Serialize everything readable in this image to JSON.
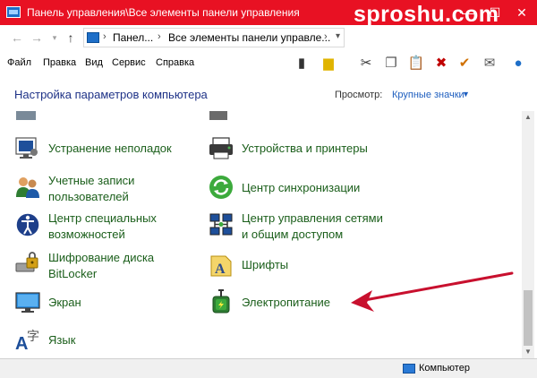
{
  "window": {
    "title": "Панель управления\\Все элементы панели управления",
    "watermark": "sproshu.com",
    "controls": {
      "minimize": "—",
      "maximize": "☐",
      "close": "✕"
    }
  },
  "address": {
    "crumbs": [
      "Панел...",
      "Все элементы панели управле..."
    ],
    "separator": "›"
  },
  "menu": {
    "items": [
      "Файл",
      "Правка",
      "Вид",
      "Сервис",
      "Справка"
    ]
  },
  "toolbar": {
    "buttons": [
      {
        "icon": "panel-icon",
        "glyph": "▮"
      },
      {
        "icon": "folder-icon",
        "glyph": "▆"
      },
      {
        "icon": "cut-icon",
        "glyph": "✂"
      },
      {
        "icon": "copy-icon",
        "glyph": "❐"
      },
      {
        "icon": "paste-icon",
        "glyph": "📋"
      },
      {
        "icon": "delete-icon",
        "glyph": "✖"
      },
      {
        "icon": "check-icon",
        "glyph": "✔"
      },
      {
        "icon": "mail-icon",
        "glyph": "✉"
      },
      {
        "icon": "globe-icon",
        "glyph": "●"
      }
    ]
  },
  "header": {
    "title": "Настройка параметров компьютера",
    "view_label": "Просмотр:",
    "view_value": "Крупные значки"
  },
  "items": [
    {
      "line1": "Устранение неполадок",
      "line2": "",
      "icon": "troubleshoot-icon"
    },
    {
      "line1": "Устройства и принтеры",
      "line2": "",
      "icon": "printer-icon"
    },
    {
      "line1": "Учетные записи",
      "line2": "пользователей",
      "icon": "users-icon"
    },
    {
      "line1": "Центр синхронизации",
      "line2": "",
      "icon": "sync-icon"
    },
    {
      "line1": "Центр специальных",
      "line2": "возможностей",
      "icon": "accessibility-icon"
    },
    {
      "line1": "Центр управления сетями",
      "line2": "и общим доступом",
      "icon": "network-icon"
    },
    {
      "line1": "Шифрование диска",
      "line2": "BitLocker",
      "icon": "bitlocker-icon"
    },
    {
      "line1": "Шрифты",
      "line2": "",
      "icon": "fonts-icon"
    },
    {
      "line1": "Экран",
      "line2": "",
      "icon": "monitor-icon"
    },
    {
      "line1": "Электропитание",
      "line2": "",
      "icon": "power-icon"
    },
    {
      "line1": "Язык",
      "line2": "",
      "icon": "language-icon"
    }
  ],
  "status": {
    "text": "Компьютер"
  },
  "colors": {
    "titlebar": "#e81123",
    "item_text": "#1a5e1a",
    "header_text": "#1e3287",
    "link": "#1f5fbf",
    "annotation": "#c8102e"
  }
}
